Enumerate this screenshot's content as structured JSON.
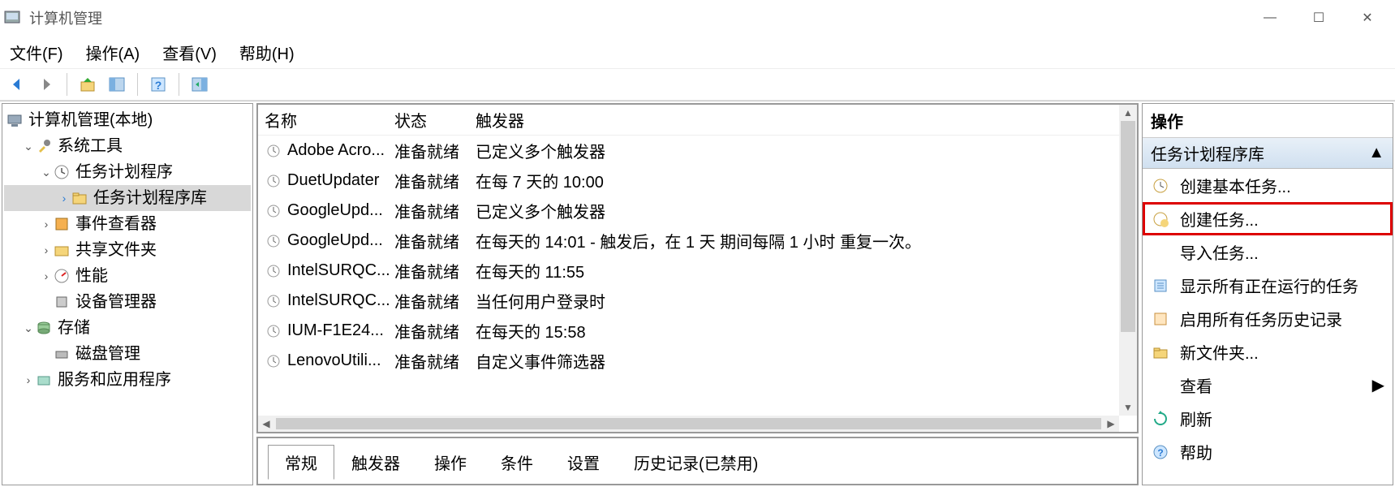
{
  "window": {
    "title": "计算机管理"
  },
  "menu": {
    "file": "文件(F)",
    "action": "操作(A)",
    "view": "查看(V)",
    "help": "帮助(H)"
  },
  "tree": {
    "root": "计算机管理(本地)",
    "system_tools": "系统工具",
    "task_scheduler": "任务计划程序",
    "task_scheduler_library": "任务计划程序库",
    "event_viewer": "事件查看器",
    "shared_folders": "共享文件夹",
    "performance": "性能",
    "device_manager": "设备管理器",
    "storage": "存储",
    "disk_management": "磁盘管理",
    "services_apps": "服务和应用程序"
  },
  "task_columns": {
    "name": "名称",
    "status": "状态",
    "trigger": "触发器"
  },
  "tasks": [
    {
      "name": "Adobe Acro...",
      "status": "准备就绪",
      "trigger": "已定义多个触发器"
    },
    {
      "name": "DuetUpdater",
      "status": "准备就绪",
      "trigger": "在每 7 天的 10:00"
    },
    {
      "name": "GoogleUpd...",
      "status": "准备就绪",
      "trigger": "已定义多个触发器"
    },
    {
      "name": "GoogleUpd...",
      "status": "准备就绪",
      "trigger": "在每天的 14:01 - 触发后，在 1 天 期间每隔 1 小时 重复一次。"
    },
    {
      "name": "IntelSURQC...",
      "status": "准备就绪",
      "trigger": "在每天的 11:55"
    },
    {
      "name": "IntelSURQC...",
      "status": "准备就绪",
      "trigger": "当任何用户登录时"
    },
    {
      "name": "IUM-F1E24...",
      "status": "准备就绪",
      "trigger": "在每天的 15:58"
    },
    {
      "name": "LenovoUtili...",
      "status": "准备就绪",
      "trigger": "自定义事件筛选器"
    }
  ],
  "detail_tabs": {
    "general": "常规",
    "triggers": "触发器",
    "actions": "操作",
    "conditions": "条件",
    "settings": "设置",
    "history": "历史记录(已禁用)"
  },
  "actions": {
    "header": "操作",
    "group_title": "任务计划程序库",
    "create_basic_task": "创建基本任务...",
    "create_task": "创建任务...",
    "import_task": "导入任务...",
    "show_running": "显示所有正在运行的任务",
    "enable_history": "启用所有任务历史记录",
    "new_folder": "新文件夹...",
    "view": "查看",
    "refresh": "刷新",
    "help": "帮助"
  }
}
